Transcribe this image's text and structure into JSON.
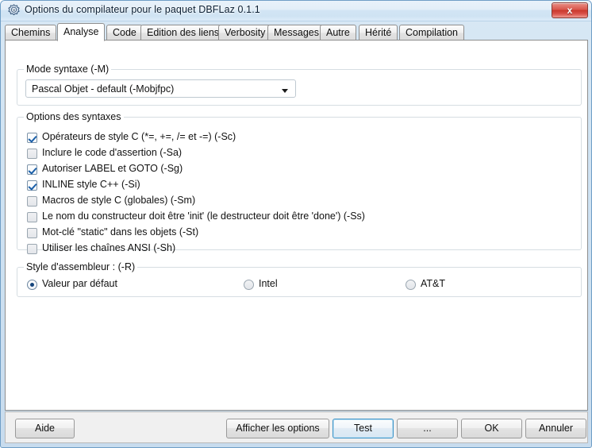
{
  "window": {
    "title": "Options du compilateur pour le paquet DBFLaz 0.1.1",
    "icon": "lazarus-package-icon",
    "close_label": "x",
    "accent_color": "#3d94c8",
    "titlebar_color": "#d2e5f4"
  },
  "tabs": [
    {
      "label": "Chemins",
      "active": false
    },
    {
      "label": "Analyse",
      "active": true
    },
    {
      "label": "Code",
      "active": false
    },
    {
      "label": "Edition des liens",
      "active": false
    },
    {
      "label": "Verbosity",
      "active": false
    },
    {
      "label": "Messages",
      "active": false
    },
    {
      "label": "Autre",
      "active": false
    },
    {
      "label": "Hérité",
      "active": false
    },
    {
      "label": "Compilation",
      "active": false
    }
  ],
  "syntax_mode_group": {
    "caption": "Mode syntaxe (-M)",
    "combo": {
      "value": "Pascal Objet - default (-Mobjfpc)",
      "arrow_icon": "chevron-down-icon"
    }
  },
  "syntax_options_group": {
    "caption": "Options des syntaxes",
    "checkboxes": [
      {
        "label": "Opérateurs de style C (*=, +=, /= et -=) (-Sc)",
        "checked": true
      },
      {
        "label": "Inclure le code d'assertion (-Sa)",
        "checked": false
      },
      {
        "label": "Autoriser LABEL et GOTO (-Sg)",
        "checked": true
      },
      {
        "label": "INLINE style C++ (-Si)",
        "checked": true
      },
      {
        "label": "Macros de style C (globales) (-Sm)",
        "checked": false
      },
      {
        "label": "Le nom du constructeur doit être 'init' (le destructeur doit être 'done') (-Ss)",
        "checked": false
      },
      {
        "label": "Mot-clé \"static\" dans les objets (-St)",
        "checked": false
      },
      {
        "label": "Utiliser les chaînes ANSI (-Sh)",
        "checked": false
      }
    ]
  },
  "assembler_group": {
    "caption": "Style d'assembleur : (-R)",
    "radios": [
      {
        "label": "Valeur par défaut",
        "checked": true
      },
      {
        "label": "Intel",
        "checked": false
      },
      {
        "label": "AT&T",
        "checked": false
      }
    ]
  },
  "buttons": {
    "help": "Aide",
    "show_options": "Afficher les options",
    "test": "Test",
    "ellipsis": "...",
    "ok": "OK",
    "cancel": "Annuler"
  }
}
